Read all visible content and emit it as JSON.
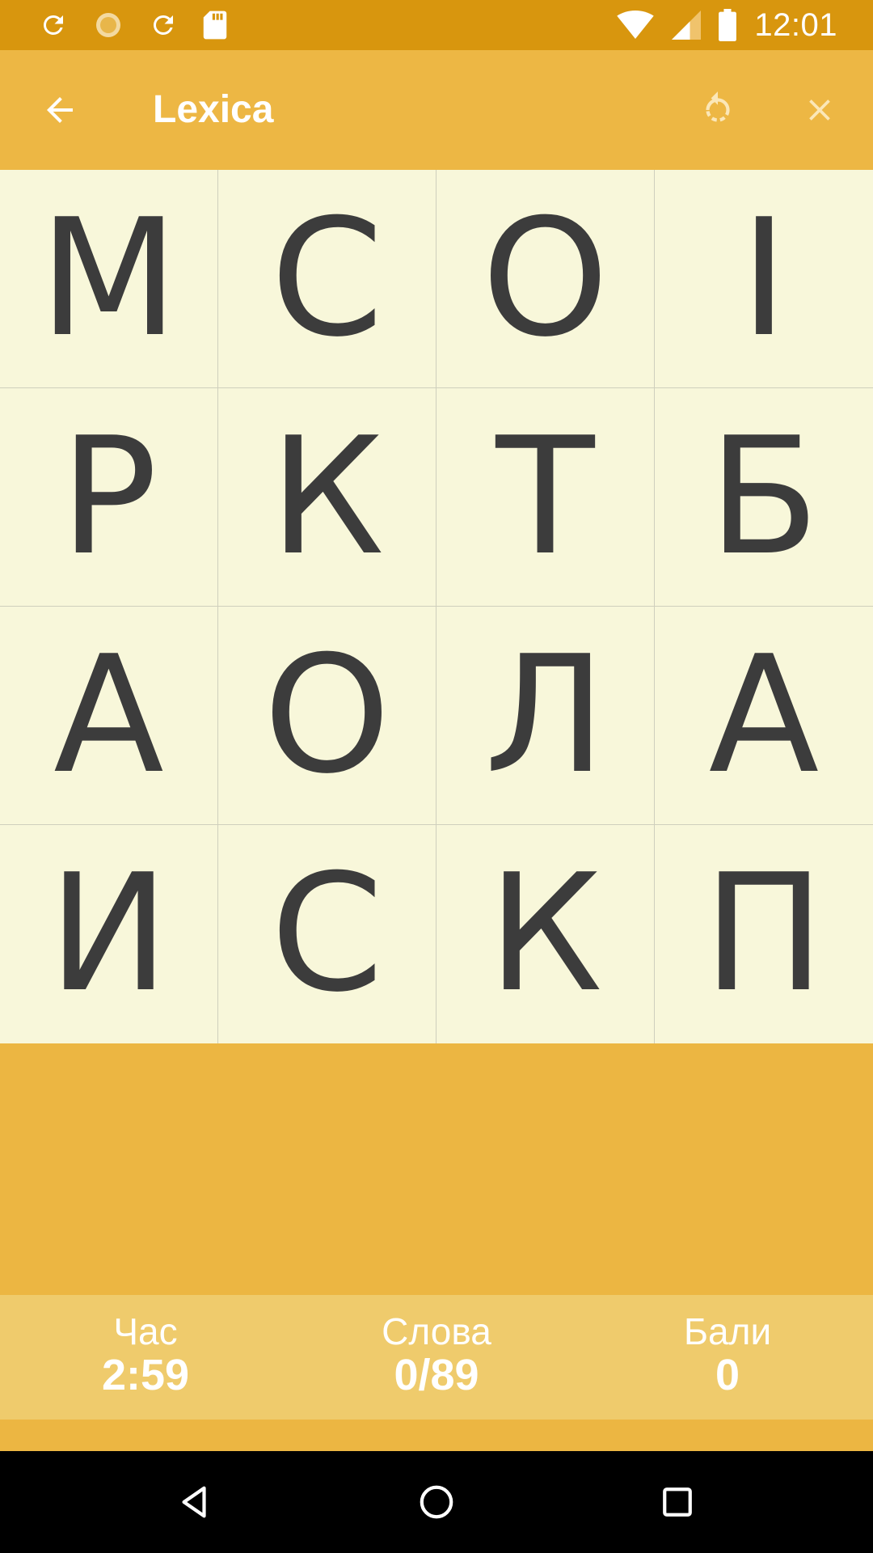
{
  "status_bar": {
    "time": "12:01",
    "left_icons": [
      "sync-icon",
      "brightness-icon",
      "sync-icon",
      "sd-card-icon"
    ],
    "right_icons": [
      "wifi-icon",
      "signal-icon",
      "battery-icon"
    ]
  },
  "app_bar": {
    "title": "Lexica",
    "back_icon": "arrow-back-icon",
    "restart_icon": "restart-icon",
    "close_icon": "close-icon"
  },
  "board": {
    "rows": [
      [
        "М",
        "С",
        "О",
        "І"
      ],
      [
        "Р",
        "К",
        "Т",
        "Б"
      ],
      [
        "А",
        "О",
        "Л",
        "А"
      ],
      [
        "И",
        "С",
        "К",
        "П"
      ]
    ]
  },
  "stats": {
    "time_label": "Час",
    "time_value": "2:59",
    "words_label": "Слова",
    "words_value": "0/89",
    "score_label": "Бали",
    "score_value": "0"
  },
  "nav_bar": {
    "icons": [
      "back-triangle-icon",
      "home-circle-icon",
      "recents-square-icon"
    ]
  },
  "colors": {
    "status_bar": "#d8960e",
    "app_bar": "#edb744",
    "tile": "#f8f7da",
    "stats_bar": "#efcb6c",
    "letter": "#3c3c3c"
  }
}
